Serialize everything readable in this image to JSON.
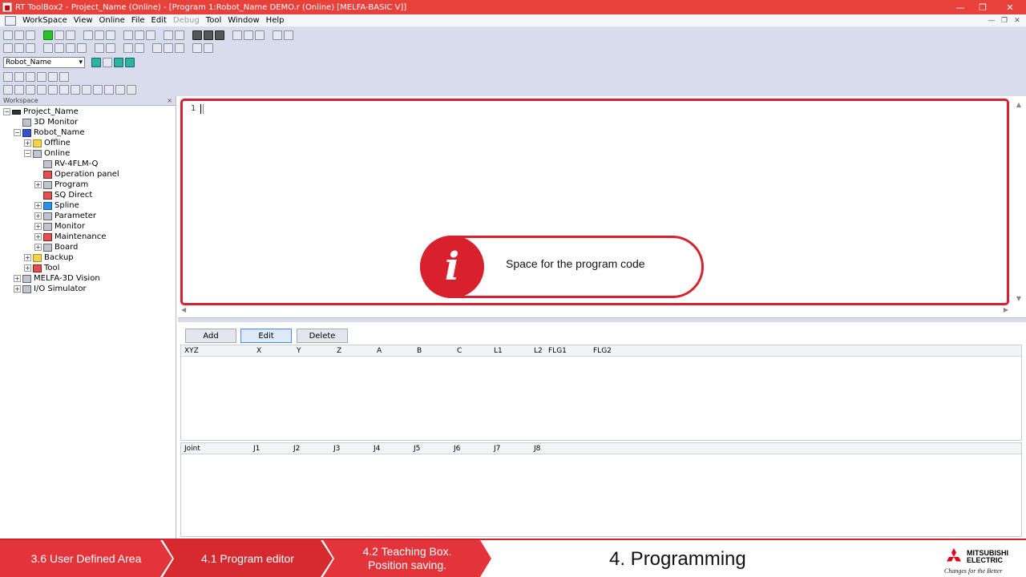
{
  "titlebar": {
    "title": "RT ToolBox2 - Project_Name  (Online) - [Program 1:Robot_Name DEMO.r (Online)  [MELFA-BASIC V]]"
  },
  "menu": {
    "items": [
      "WorkSpace",
      "View",
      "Online",
      "File",
      "Edit",
      "Debug",
      "Tool",
      "Window",
      "Help"
    ]
  },
  "toolbar": {
    "robot_select": "Robot_Name"
  },
  "workspace": {
    "header": "Workspace",
    "close": "×",
    "tree": [
      {
        "label": "Project_Name"
      },
      {
        "label": "3D Monitor"
      },
      {
        "label": "Robot_Name"
      },
      {
        "label": "Offline"
      },
      {
        "label": "Online"
      },
      {
        "label": "RV-4FLM-Q"
      },
      {
        "label": "Operation panel"
      },
      {
        "label": "Program"
      },
      {
        "label": "SQ Direct"
      },
      {
        "label": "Spline"
      },
      {
        "label": "Parameter"
      },
      {
        "label": "Monitor"
      },
      {
        "label": "Maintenance"
      },
      {
        "label": "Board"
      },
      {
        "label": "Backup"
      },
      {
        "label": "Tool"
      },
      {
        "label": "MELFA-3D Vision"
      },
      {
        "label": "I/O Simulator"
      }
    ]
  },
  "editor": {
    "line_number": "1",
    "callout_icon": "i",
    "callout_text": "Space for the program code"
  },
  "positions": {
    "buttons": {
      "add": "Add",
      "edit": "Edit",
      "delete": "Delete"
    },
    "xyz_headers": [
      "XYZ",
      "X",
      "Y",
      "Z",
      "A",
      "B",
      "C",
      "L1",
      "L2",
      "FLG1",
      "FLG2"
    ],
    "joint_headers": [
      "Joint",
      "J1",
      "J2",
      "J3",
      "J4",
      "J5",
      "J6",
      "J7",
      "J8"
    ]
  },
  "bottom_nav": {
    "seg1": "3.6 User Defined Area",
    "seg2": "4.1 Program editor",
    "seg3_line1": "4.2 Teaching Box.",
    "seg3_line2": "Position saving.",
    "title": "4. Programming",
    "logo_line1": "MITSUBISHI",
    "logo_line2": "ELECTRIC",
    "logo_slogan": "Changes for the Better"
  },
  "colors": {
    "accent_red": "#d9202d",
    "titlebar_red": "#e8413b",
    "toolbar_bg": "#d8dcec"
  }
}
